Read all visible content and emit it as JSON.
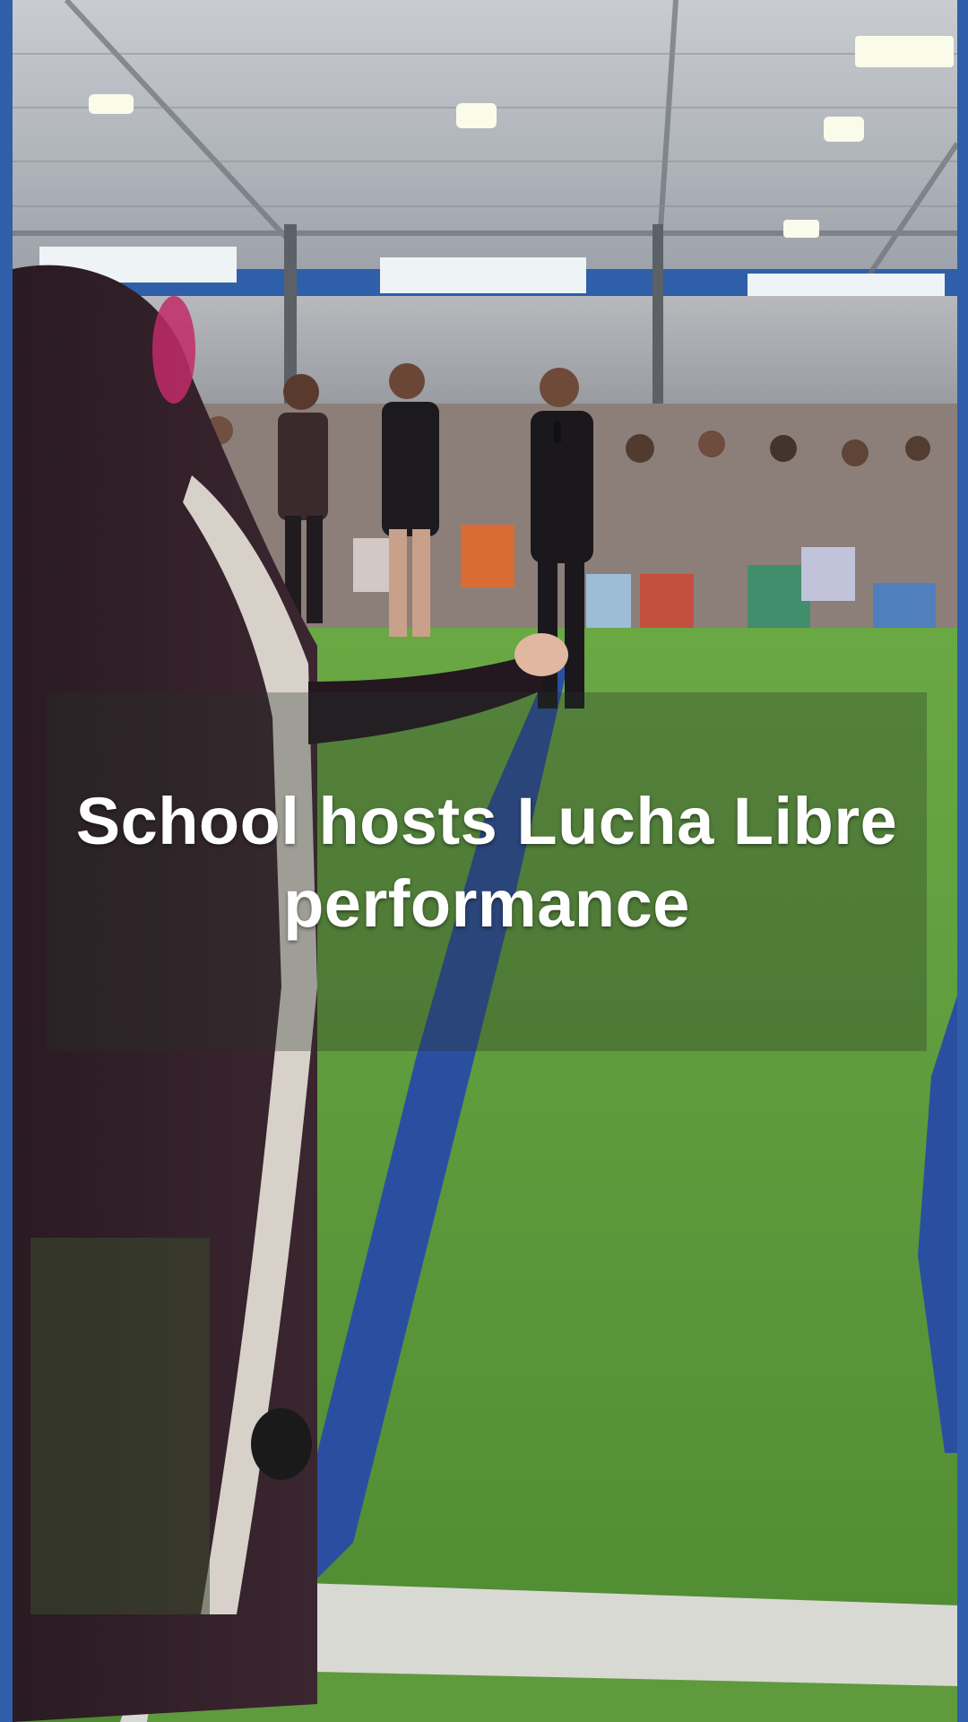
{
  "video": {
    "caption": "School hosts Lucha Libre performance"
  },
  "colors": {
    "frame_border": "#2f5fa8",
    "turf_green": "#5f9a3d",
    "turf_line_blue": "#2b4fa0",
    "ceiling_gray": "#b9bcc2",
    "caption_text": "#ffffff"
  }
}
